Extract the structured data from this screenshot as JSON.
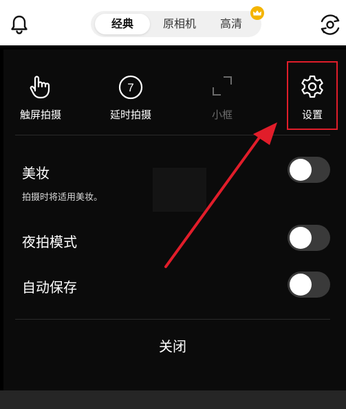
{
  "top_bar": {
    "modes": [
      {
        "label": "经典",
        "active": true
      },
      {
        "label": "原相机",
        "active": false
      },
      {
        "label": "高清",
        "active": false
      }
    ],
    "bell_icon": "bell-icon",
    "switch_camera_icon": "switch-camera-icon",
    "crown_icon": "crown-icon"
  },
  "tools": [
    {
      "label": "触屏拍摄",
      "icon": "touch-hand-icon",
      "enabled": true
    },
    {
      "label": "延时拍摄",
      "icon": "timer-7-icon",
      "timer_value": "7",
      "enabled": true
    },
    {
      "label": "小框",
      "icon": "small-frame-icon",
      "enabled": false
    },
    {
      "label": "设置",
      "icon": "gear-icon",
      "enabled": true
    }
  ],
  "settings": {
    "beauty": {
      "title": "美妆",
      "subtitle": "拍摄时将适用美妆。",
      "on": false
    },
    "night_mode": {
      "title": "夜拍模式",
      "on": false
    },
    "auto_save": {
      "title": "自动保存",
      "on": false
    }
  },
  "close_label": "关闭",
  "colors": {
    "highlight": "#e11d2a",
    "arrow": "#e11d2a",
    "crown": "#f4b400",
    "panel_bg": "#0b0b0b"
  }
}
